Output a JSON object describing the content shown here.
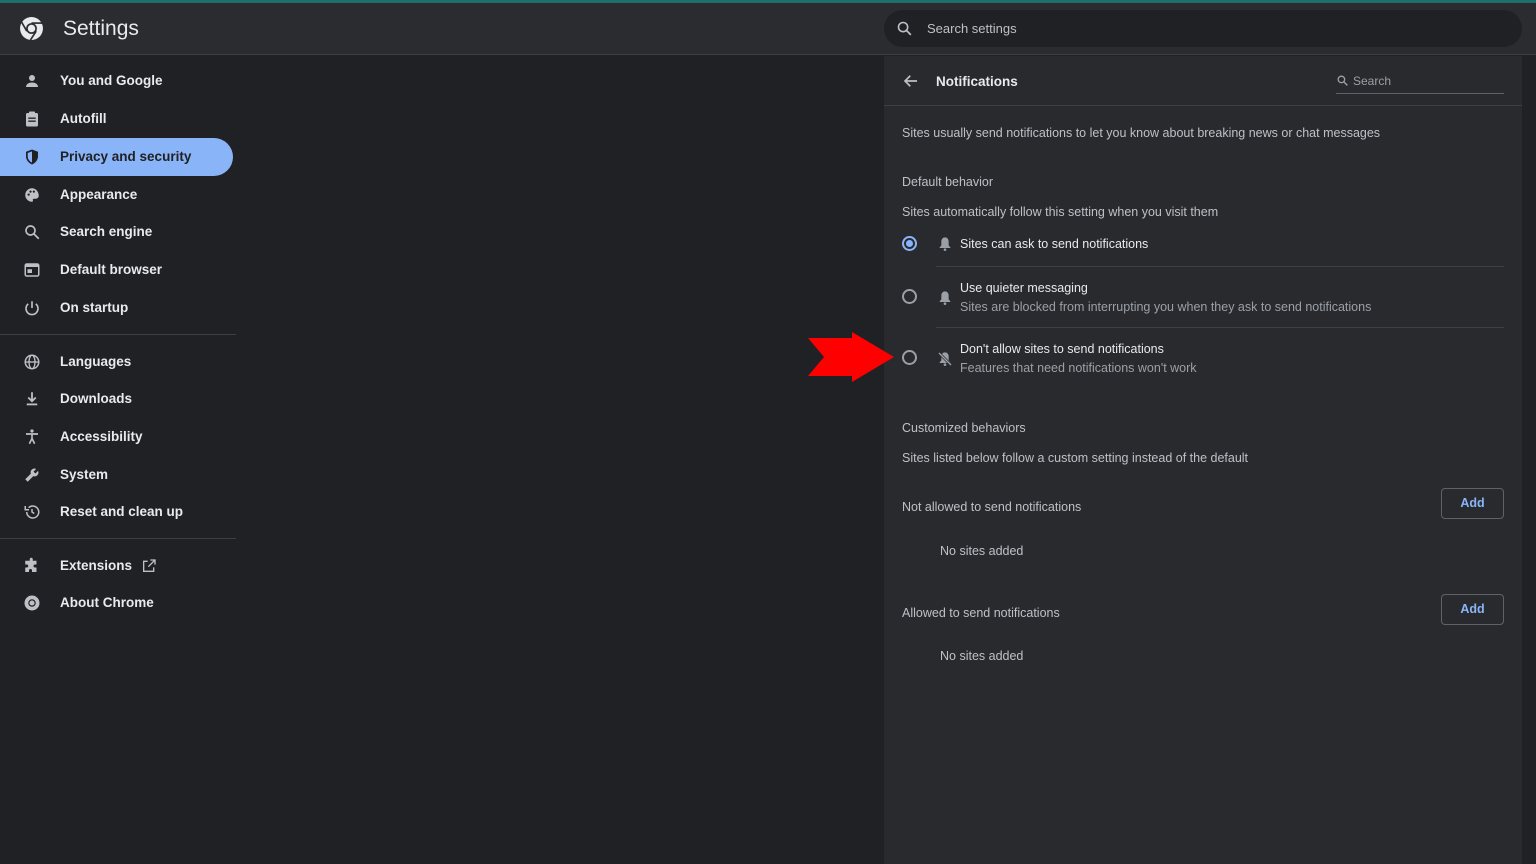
{
  "header": {
    "title": "Settings",
    "search_placeholder": "Search settings"
  },
  "sidebar": {
    "items": [
      {
        "label": "You and Google",
        "icon": "person-icon"
      },
      {
        "label": "Autofill",
        "icon": "clipboard-icon"
      },
      {
        "label": "Privacy and security",
        "icon": "shield-icon",
        "active": true
      },
      {
        "label": "Appearance",
        "icon": "palette-icon"
      },
      {
        "label": "Search engine",
        "icon": "search-icon"
      },
      {
        "label": "Default browser",
        "icon": "browser-icon"
      },
      {
        "label": "On startup",
        "icon": "power-icon"
      },
      {
        "label": "Languages",
        "icon": "globe-icon"
      },
      {
        "label": "Downloads",
        "icon": "download-icon"
      },
      {
        "label": "Accessibility",
        "icon": "accessibility-icon"
      },
      {
        "label": "System",
        "icon": "wrench-icon"
      },
      {
        "label": "Reset and clean up",
        "icon": "restore-icon"
      },
      {
        "label": "Extensions",
        "icon": "puzzle-icon"
      },
      {
        "label": "About Chrome",
        "icon": "chrome-icon"
      }
    ]
  },
  "notifications": {
    "title": "Notifications",
    "search_placeholder": "Search",
    "intro": "Sites usually send notifications to let you know about breaking news or chat messages",
    "default_behavior": {
      "heading": "Default behavior",
      "description": "Sites automatically follow this setting when you visit them",
      "options": [
        {
          "label": "Sites can ask to send notifications",
          "sublabel": "",
          "selected": true,
          "icon": "bell-icon"
        },
        {
          "label": "Use quieter messaging",
          "sublabel": "Sites are blocked from interrupting you when they ask to send notifications",
          "selected": false,
          "icon": "bell-icon"
        },
        {
          "label": "Don't allow sites to send notifications",
          "sublabel": "Features that need notifications won't work",
          "selected": false,
          "icon": "bell-off-icon"
        }
      ]
    },
    "customized": {
      "heading": "Customized behaviors",
      "description": "Sites listed below follow a custom setting instead of the default",
      "lists": [
        {
          "title": "Not allowed to send notifications",
          "add_label": "Add",
          "empty_text": "No sites added"
        },
        {
          "title": "Allowed to send notifications",
          "add_label": "Add",
          "empty_text": "No sites added"
        }
      ]
    }
  },
  "colors": {
    "accent": "#8ab4f8",
    "annotation_arrow": "#ff0000",
    "background": "#202124",
    "panel": "#292a2d"
  }
}
